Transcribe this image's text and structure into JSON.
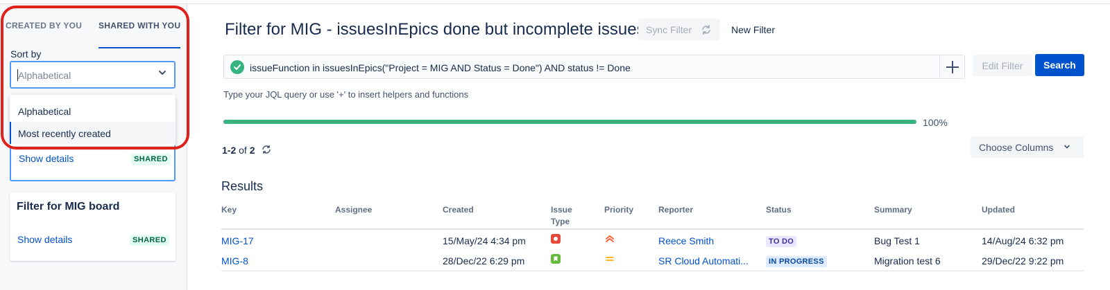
{
  "sidebar": {
    "tabs": [
      {
        "label": "CREATED BY YOU",
        "active": false
      },
      {
        "label": "SHARED WITH YOU",
        "active": true
      }
    ],
    "sort_label": "Sort by",
    "sort_select": {
      "value": "Alphabetical"
    },
    "sort_options": [
      "Alphabetical",
      "Most recently created"
    ],
    "cards": [
      {
        "title": "",
        "link": "Show details",
        "badge": "SHARED"
      },
      {
        "title": "Filter for MIG board",
        "link": "Show details",
        "badge": "SHARED"
      }
    ]
  },
  "header": {
    "title": "Filter for MIG - issuesInEpics done but incomplete issues",
    "sync_filter": "Sync Filter",
    "new_filter": "New Filter"
  },
  "query": {
    "text": "issueFunction in issuesInEpics(\"Project = MIG AND Status = Done\") AND status != Done",
    "hint": "Type your JQL query or use '+' to insert helpers and functions",
    "edit_filter": "Edit Filter",
    "search": "Search"
  },
  "progress": {
    "value": 100,
    "label": "100%"
  },
  "results": {
    "range": "1-2",
    "of_text": "of",
    "total": "2",
    "choose_columns": "Choose Columns",
    "title": "Results",
    "columns": [
      "Key",
      "Assignee",
      "Created",
      "Issue Type",
      "Priority",
      "Reporter",
      "Status",
      "Summary",
      "Updated"
    ],
    "rows": [
      {
        "key": "MIG-17",
        "assignee": "",
        "created": "15/May/24 4:34 pm",
        "type_icon": "bug-icon",
        "priority_icon": "highest-priority-icon",
        "reporter": "Reece Smith",
        "status": "TO DO",
        "summary": "Bug Test 1",
        "updated": "14/Aug/24 6:32 pm"
      },
      {
        "key": "MIG-8",
        "assignee": "",
        "created": "28/Dec/22 6:29 pm",
        "type_icon": "story-icon",
        "priority_icon": "medium-priority-icon",
        "reporter": "SR Cloud Automati...",
        "status": "IN PROGRESS",
        "summary": "Migration test 6",
        "updated": "29/Dec/22 9:22 pm"
      }
    ]
  },
  "colors": {
    "accent": "#0052cc",
    "success": "#36b37e",
    "highlight": "#e0201b",
    "bug": "#e5493a",
    "story": "#63ba3c",
    "priority_highest": "#ff5630",
    "priority_medium": "#ffab00"
  }
}
